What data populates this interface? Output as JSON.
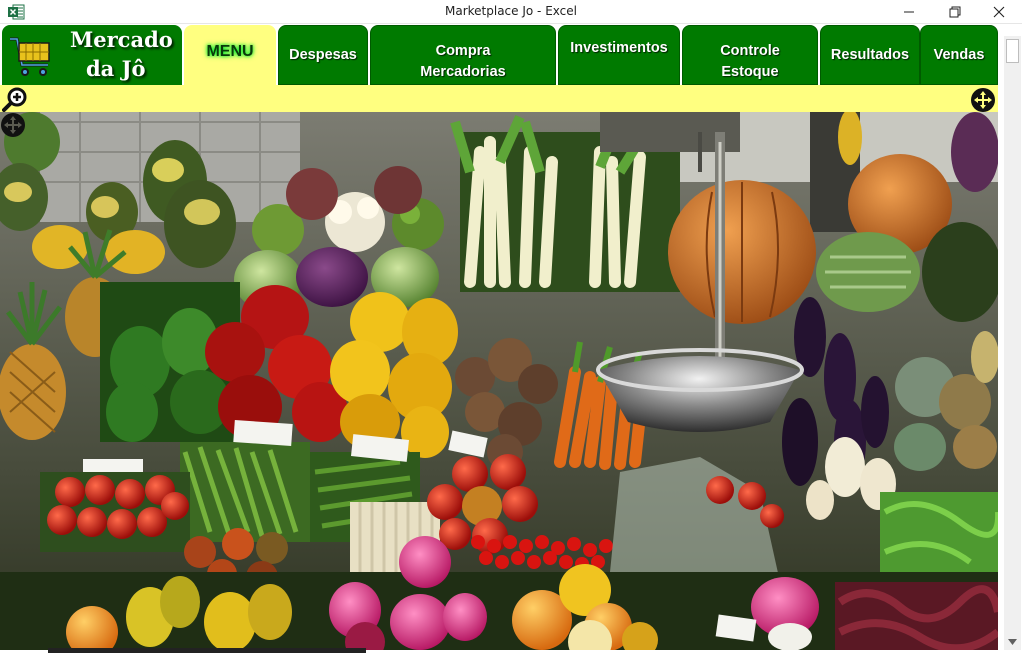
{
  "window": {
    "title": "Marketplace Jo - Excel",
    "app_icon": "excel-icon"
  },
  "logo": {
    "line1": "Mercado",
    "line2": "da Jô",
    "icon": "shopping-cart-icon"
  },
  "tabs": [
    {
      "label": "MENU",
      "active": true
    },
    {
      "label": "Despesas",
      "active": false
    },
    {
      "label": "Compra\nMercadorias",
      "active": false
    },
    {
      "label": "Investimentos",
      "active": false
    },
    {
      "label": "Controle\nEstoque",
      "active": false
    },
    {
      "label": "Resultados",
      "active": false
    },
    {
      "label": "Vendas",
      "active": false
    }
  ],
  "toolbar": {
    "zoom_icon": "zoom-in-icon",
    "move_icon": "move-icon"
  },
  "colors": {
    "tab_green": "#007a00",
    "active_tab_yellow": "#ffff80",
    "strip_yellow": "#ffff80"
  },
  "photo": {
    "subject": "vegetable-market-stall-photo"
  }
}
